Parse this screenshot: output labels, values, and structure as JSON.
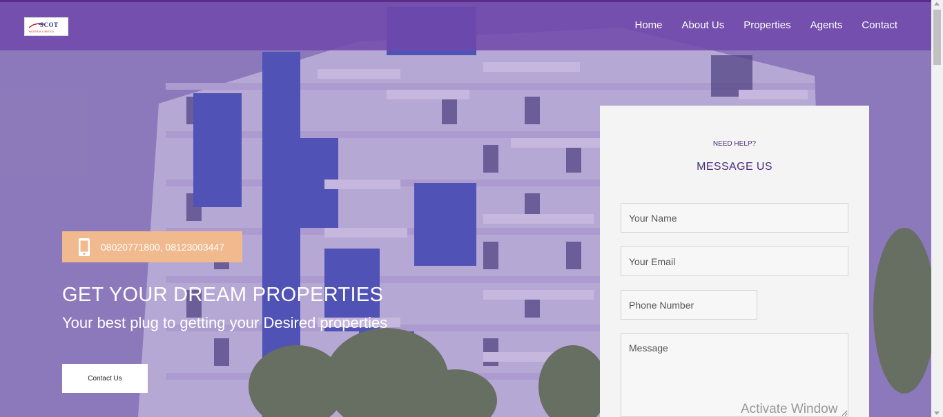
{
  "logo": {
    "text": "SCOT",
    "subtitle": "NIGERIA LIMITED"
  },
  "nav": {
    "items": [
      {
        "label": "Home"
      },
      {
        "label": "About Us"
      },
      {
        "label": "Properties"
      },
      {
        "label": "Agents"
      },
      {
        "label": "Contact"
      }
    ]
  },
  "hero": {
    "phone": "08020771800, 08123003447",
    "title": "GET YOUR DREAM PROPERTIES",
    "subtitle": "Your best plug to getting your Desired properties",
    "cta_label": "Contact Us"
  },
  "form": {
    "eyebrow": "NEED HELP?",
    "heading": "MESSAGE US",
    "name_placeholder": "Your Name",
    "email_placeholder": "Your Email",
    "phone_placeholder": "Phone Number",
    "message_placeholder": "Message"
  },
  "watermark": "Activate Window",
  "colors": {
    "nav_bg": "#7048aa",
    "accent_orange": "#f1b98e",
    "heading_purple": "#4a2d7a",
    "panel_bg": "#f4f4f4"
  },
  "icons": {
    "phone": "mobile-phone-icon",
    "logo": "airplane-swoosh-icon"
  }
}
